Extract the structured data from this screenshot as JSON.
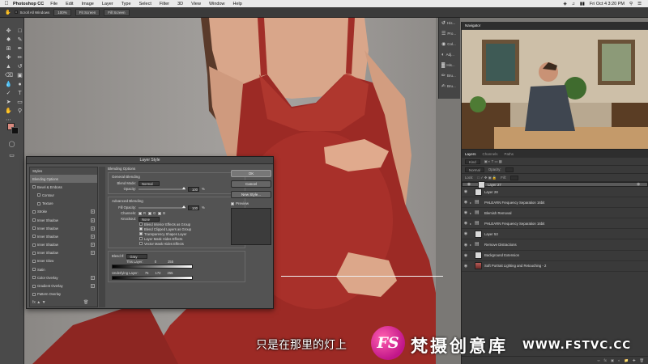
{
  "menubar": {
    "app_name": "Photoshop CC",
    "items": [
      "File",
      "Edit",
      "Image",
      "Layer",
      "Type",
      "Select",
      "Filter",
      "3D",
      "View",
      "Window",
      "Help"
    ],
    "clock": "Fri Oct 4  3:20 PM"
  },
  "options_bar": {
    "scroll_all": "Scroll All Windows",
    "zoom": "100%",
    "fit_screen": "Fit Screen",
    "fill_screen": "Fill Screen"
  },
  "icon_strip": {
    "items": [
      {
        "icon": "history-icon",
        "label": "His..."
      },
      {
        "icon": "properties-icon",
        "label": "Pro..."
      },
      {
        "icon": "color-icon",
        "label": "Col..."
      },
      {
        "icon": "adjustments-icon",
        "label": "Adj..."
      },
      {
        "icon": "histogram-icon",
        "label": "His..."
      },
      {
        "icon": "brush-icon",
        "label": "Bru..."
      },
      {
        "icon": "brush-settings-icon",
        "label": "Bru..."
      }
    ]
  },
  "navigator": {
    "tab": "Navigator"
  },
  "layers_panel": {
    "tabs": [
      "Layers",
      "Channels",
      "Paths"
    ],
    "kind": "Kind",
    "blend": "Normal",
    "opacity_label": "Opacity:",
    "lock_label": "Lock:",
    "fill_label": "Fill:",
    "layers": [
      {
        "name": "Layer 27",
        "type": "layer",
        "selected": true
      },
      {
        "name": "Layer 28",
        "type": "layer",
        "selected": false
      },
      {
        "name": "PHLEARN Frequency Separation 16bit",
        "type": "folder",
        "selected": false
      },
      {
        "name": "Blemish Removal",
        "type": "folder",
        "selected": false
      },
      {
        "name": "PHLEARN Frequency Separation 16bit",
        "type": "folder",
        "selected": false
      },
      {
        "name": "Layer 53",
        "type": "layer",
        "selected": false
      },
      {
        "name": "Remove Distractions",
        "type": "folder",
        "selected": false
      },
      {
        "name": "Background Extension",
        "type": "layer",
        "selected": false
      },
      {
        "name": "Soft Portrait Lighting and Retouching - 2",
        "type": "photo",
        "selected": false
      }
    ]
  },
  "layer_style": {
    "title": "Layer Style",
    "styles_header": "Styles",
    "styles": [
      {
        "label": "Blending Options",
        "checkbox": false,
        "plus": false,
        "active": true
      },
      {
        "label": "Bevel & Emboss",
        "checkbox": true,
        "plus": false,
        "active": false
      },
      {
        "label": "Contour",
        "checkbox": true,
        "plus": false,
        "active": false,
        "indent": true
      },
      {
        "label": "Texture",
        "checkbox": true,
        "plus": false,
        "active": false,
        "indent": true
      },
      {
        "label": "Stroke",
        "checkbox": true,
        "plus": true,
        "active": false
      },
      {
        "label": "Inner Shadow",
        "checkbox": true,
        "plus": true,
        "active": false
      },
      {
        "label": "Inner Shadow",
        "checkbox": true,
        "plus": true,
        "active": false
      },
      {
        "label": "Inner Shadow",
        "checkbox": true,
        "plus": true,
        "active": false
      },
      {
        "label": "Inner Shadow",
        "checkbox": true,
        "plus": true,
        "active": false
      },
      {
        "label": "Inner Shadow",
        "checkbox": true,
        "plus": true,
        "active": false
      },
      {
        "label": "Inner Glow",
        "checkbox": true,
        "plus": false,
        "active": false
      },
      {
        "label": "Satin",
        "checkbox": true,
        "plus": false,
        "active": false
      },
      {
        "label": "Color Overlay",
        "checkbox": true,
        "plus": true,
        "active": false
      },
      {
        "label": "Gradient Overlay",
        "checkbox": true,
        "plus": true,
        "active": false
      },
      {
        "label": "Pattern Overlay",
        "checkbox": true,
        "plus": false,
        "active": false
      }
    ],
    "blending_options": "Blending Options",
    "general_blending": "General Blending",
    "blend_mode_label": "Blend Mode:",
    "blend_mode_value": "Normal",
    "opacity_label": "Opacity:",
    "opacity_value": "100",
    "percent": "%",
    "advanced_blending": "Advanced Blending",
    "fill_opacity_label": "Fill Opacity:",
    "fill_opacity_value": "100",
    "channels_label": "Channels:",
    "channel_r": "R",
    "channel_g": "G",
    "channel_b": "B",
    "knockout_label": "Knockout:",
    "knockout_value": "None",
    "checks": [
      {
        "label": "Blend Interior Effects as Group",
        "checked": false
      },
      {
        "label": "Blend Clipped Layers as Group",
        "checked": true
      },
      {
        "label": "Transparency Shapes Layer",
        "checked": true
      },
      {
        "label": "Layer Mask Hides Effects",
        "checked": false
      },
      {
        "label": "Vector Mask Hides Effects",
        "checked": false
      }
    ],
    "blend_if_label": "Blend If:",
    "blend_if_value": "Gray",
    "this_layer_label": "This Layer:",
    "this_layer_low": "0",
    "this_layer_high": "255",
    "underlying_label": "Underlying Layer:",
    "underlying_low": "75",
    "underlying_mid": "172",
    "underlying_high": "255",
    "ok": "OK",
    "cancel": "Cancel",
    "new_style": "New Style...",
    "preview": "Preview"
  },
  "overlay": {
    "subtitle": "只是在那里的灯上",
    "logo_text": "FS",
    "brand_cn": "梵摄创意库",
    "brand_url": "WWW.FSTVC.CC"
  },
  "colors": {
    "foreground": "#d98a7f",
    "background": "#111111",
    "dress": "#9c2a25",
    "logo": "#d81b8f"
  }
}
